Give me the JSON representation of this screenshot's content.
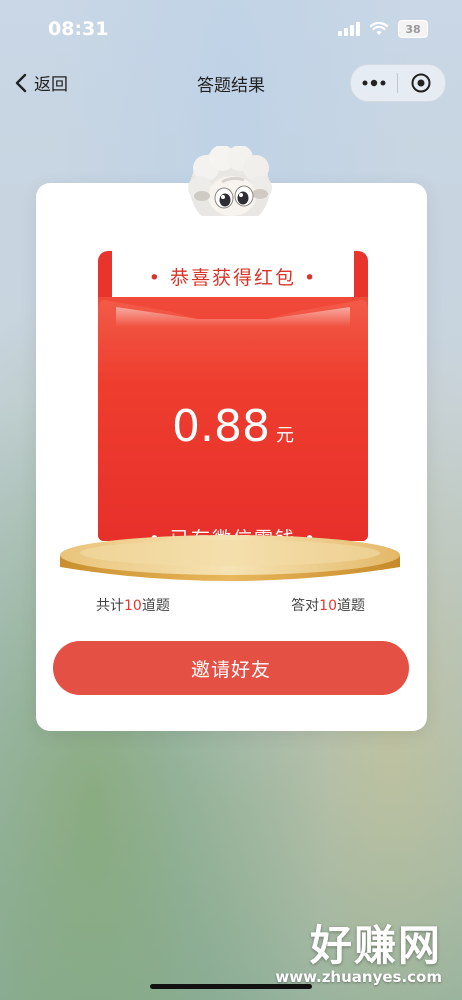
{
  "status_bar": {
    "time": "08:31",
    "battery": "38"
  },
  "nav": {
    "back_label": "返回",
    "title": "答题结果"
  },
  "red_packet": {
    "title": "• 恭喜获得红包 •",
    "amount": "0.88",
    "unit": "元",
    "status": "• 已存微信零钱 •"
  },
  "stats": {
    "total_prefix": "共计",
    "total_num": "10",
    "total_suffix": "道题",
    "correct_prefix": "答对",
    "correct_num": "10",
    "correct_suffix": "道题"
  },
  "invite_label": "邀请好友",
  "watermark": {
    "main": "好赚网",
    "sub": "www.zhuanyes.com"
  },
  "colors": {
    "accent_red": "#e8382e",
    "button_red": "#e55045"
  }
}
